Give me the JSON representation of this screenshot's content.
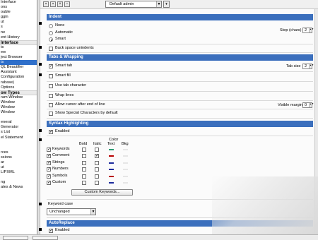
{
  "tree": {
    "items": [
      {
        "label": "Interface",
        "bold": false
      },
      {
        "label": "ons",
        "bold": false
      },
      {
        "label": "ouble",
        "bold": false
      },
      {
        "label": "ggin",
        "bold": false
      },
      {
        "label": "ut",
        "bold": false
      },
      {
        "label": "s",
        "bold": false
      },
      {
        "label": "ne",
        "bold": false
      },
      {
        "label": "ent History",
        "bold": false
      },
      {
        "label": "Interface",
        "bold": true
      },
      {
        "label": "ts",
        "bold": false
      },
      {
        "label": "ew",
        "bold": false
      },
      {
        "label": "ject Browser",
        "bold": false
      },
      {
        "label": "ts",
        "bold": false,
        "selected": true
      },
      {
        "label": "QL Beautifier",
        "bold": false
      },
      {
        "label": "Assistant",
        "bold": false
      },
      {
        "label": "Configuration",
        "bold": false
      },
      {
        "label": "rabase)",
        "bold": false
      },
      {
        "label": "Options",
        "bold": false
      },
      {
        "label": "ow Types",
        "bold": true
      },
      {
        "label": "ram Window",
        "bold": false
      },
      {
        "label": "Window",
        "bold": false
      },
      {
        "label": "Window",
        "bold": false
      },
      {
        "label": "Window",
        "bold": false
      },
      {
        "label": "",
        "bold": false
      },
      {
        "label": "eneral",
        "bold": false
      },
      {
        "label": "Generator",
        "bold": false
      },
      {
        "label": "s List",
        "bold": false
      },
      {
        "label": "el Statement",
        "bold": false
      },
      {
        "label": "",
        "bold": false
      },
      {
        "label": "",
        "bold": false
      },
      {
        "label": "rces",
        "bold": false
      },
      {
        "label": "ssions",
        "bold": false
      },
      {
        "label": "ar",
        "bold": false
      },
      {
        "label": "ut",
        "bold": false
      },
      {
        "label": "L/PXML",
        "bold": false
      },
      {
        "label": "",
        "bold": false
      },
      {
        "label": "ng",
        "bold": false
      },
      {
        "label": "ates & News",
        "bold": false
      }
    ]
  },
  "scheme": {
    "selected": "Default admin"
  },
  "sections": {
    "indent": "Indent",
    "tabs": "Tabs & Wrapping",
    "syntax": "Syntax Highlighting",
    "autoreplace": "AutoReplace"
  },
  "indent": {
    "none": "None",
    "automatic": "Automatic",
    "smart": "Smart",
    "step_label": "Step (chars)",
    "step_value": "2",
    "backspace": "Back space unindents"
  },
  "tabs": {
    "smart_tab": "Smart tab",
    "tab_size_label": "Tab size",
    "tab_size_value": "2",
    "smart_fill": "Smart fill",
    "use_tab_char": "Use tab character",
    "wrap_lines": "Wrap lines",
    "cursor_after_eol": "Allow cursor after end of line",
    "visible_margin_label": "Visible margin",
    "visible_margin_value": "0",
    "show_special": "Show Special Characters by default"
  },
  "syntax": {
    "enabled": "Enabled",
    "headers": {
      "bold": "Bold",
      "italic": "Italic",
      "color": "Color",
      "text": "Text",
      "bkg": "Bkg"
    },
    "rows": [
      {
        "label": "Keywords",
        "color": "#2a9a73"
      },
      {
        "label": "Comment",
        "color": "#b80000"
      },
      {
        "label": "Strings",
        "color": "#1b2a9c"
      },
      {
        "label": "Numbers",
        "color": "#1b2a9c"
      },
      {
        "label": "Symbols",
        "color": "#b80000"
      },
      {
        "label": "Custom",
        "color": "#1b2a9c"
      }
    ],
    "custom_button": "Custom Keywords...",
    "keyword_case_label": "Keyword case",
    "keyword_case_value": "Unchanged"
  },
  "autoreplace": {
    "enabled": "Enabled"
  }
}
